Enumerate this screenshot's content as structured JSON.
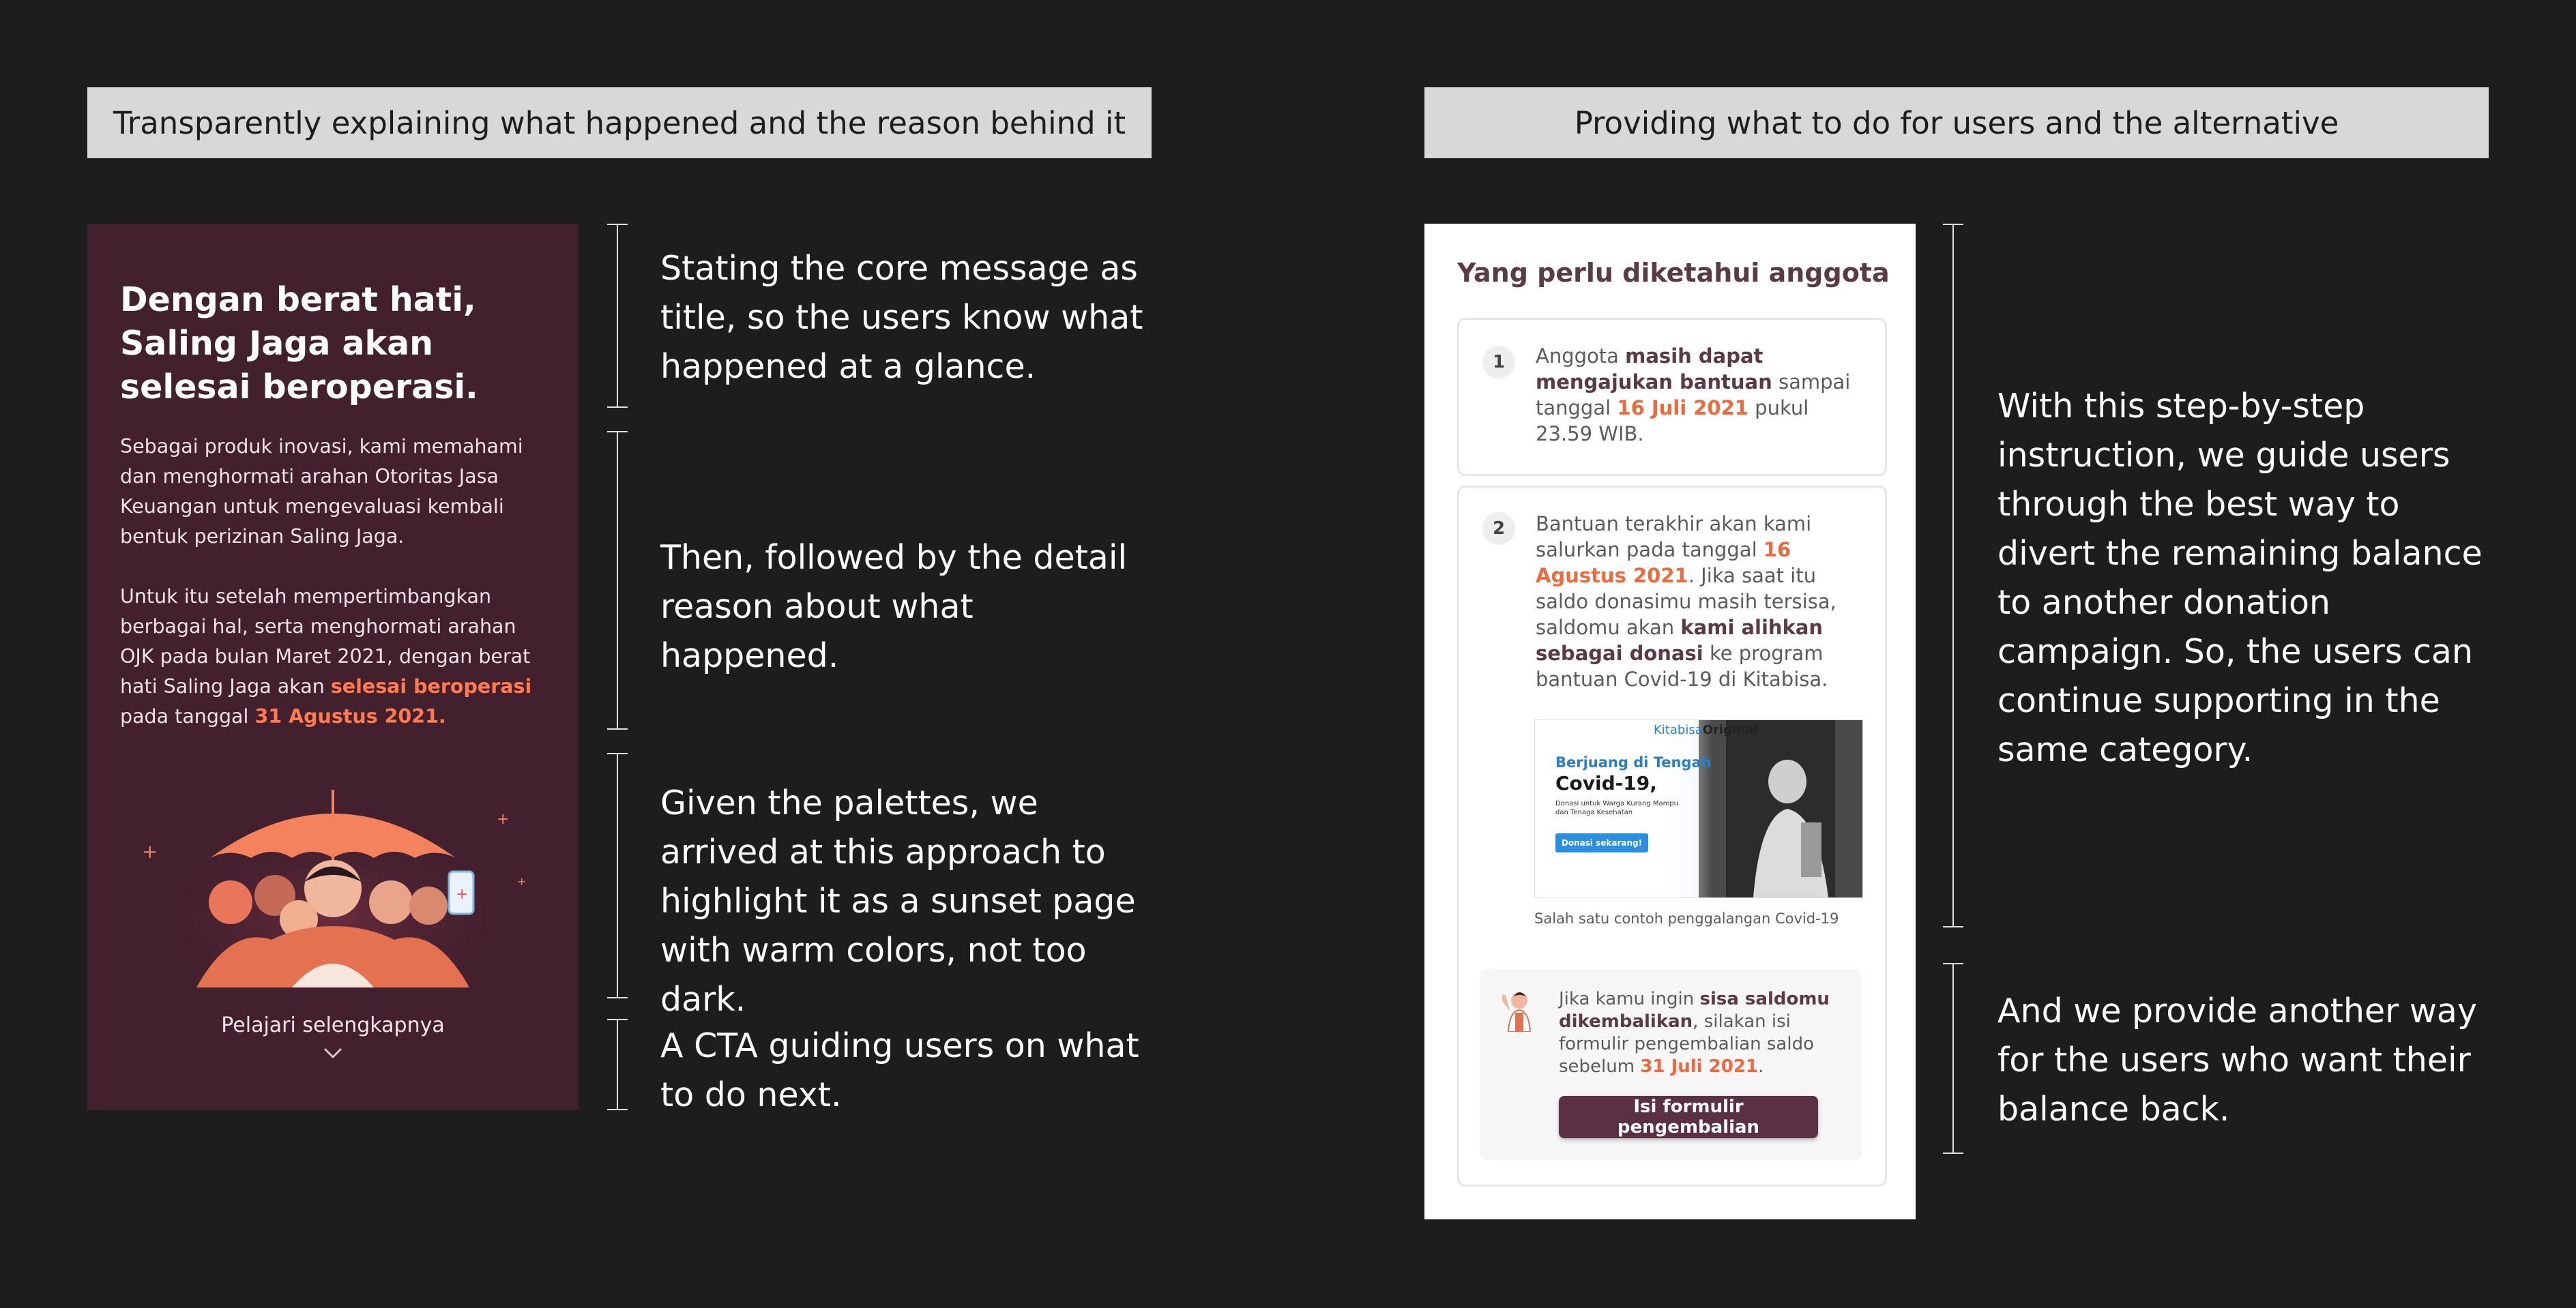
{
  "left_section": {
    "header": "Transparently explaining what happened and the reason behind it",
    "notes": [
      "Stating the core message as title, so the users know what happened at a glance.",
      "Then, followed by the detail reason about what happened.",
      "Given the palettes, we arrived at this approach to highlight it as a sunset page with warm colors, not too dark.",
      "A CTA guiding users on what to do next."
    ]
  },
  "right_section": {
    "header": "Providing what to do for users and the alternative",
    "notes": [
      "With this step-by-step instruction, we guide users through the best way to divert the remaining balance to another donation campaign. So, the users can continue supporting in the same category.",
      "And we provide another way for the users who want their balance back."
    ]
  },
  "sunset_screen": {
    "title": "Dengan berat hati, Saling Jaga akan selesai beroperasi.",
    "paragraph1": "Sebagai produk inovasi, kami memahami dan menghormati arahan Otoritas Jasa Keuangan untuk mengevaluasi kembali bentuk perizinan Saling Jaga.",
    "paragraph2_before": "Untuk itu setelah mempertimbangkan berbagai hal, serta menghormati arahan OJK pada bulan Maret 2021, dengan berat hati Saling Jaga akan ",
    "paragraph2_highlight": "selesai beroperasi",
    "paragraph2_middle": " pada tanggal ",
    "paragraph2_date": "31 Agustus 2021.",
    "cta_label": "Pelajari selengkapnya"
  },
  "info_screen": {
    "title": "Yang perlu diketahui anggota",
    "step1": {
      "number": "1",
      "t1": "Anggota ",
      "b1": "masih dapat mengajukan bantuan",
      "t2": " sampai tanggal ",
      "date": "16 Juli 2021",
      "t3": " pukul 23.59 WIB."
    },
    "step2": {
      "number": "2",
      "t1": "Bantuan terakhir akan kami salurkan pada tanggal ",
      "date": "16 Agustus 2021",
      "t2": ". Jika saat itu saldo donasimu masih tersisa, saldomu akan ",
      "b1": "kami alihkan sebagai donasi",
      "t3": " ke program bantuan Covid-19 di Kitabisa."
    },
    "promo": {
      "brand": "Kitabisa",
      "brand_suffix": "Original",
      "headline1": "Berjuang di Tengah",
      "headline2": "Covid-19,",
      "sub": "Donasi untuk Warga Kurang Mampu dan Tenaga Kesehatan",
      "button": "Donasi sekarang!"
    },
    "caption": "Salah satu contoh penggalangan Covid-19",
    "refund": {
      "t1": "Jika kamu ingin ",
      "b1": "sisa saldomu dikembalikan",
      "t2": ", silakan isi formulir pengembalian saldo sebelum ",
      "date": "31 Juli 2021",
      "t3": ".",
      "button": "Isi formulir pengembalian"
    }
  },
  "colors": {
    "background": "#1e1d1d",
    "sunset_bg": "#42202e",
    "accent_orange": "#ff7b4f",
    "button_plum": "#5b2f44"
  }
}
